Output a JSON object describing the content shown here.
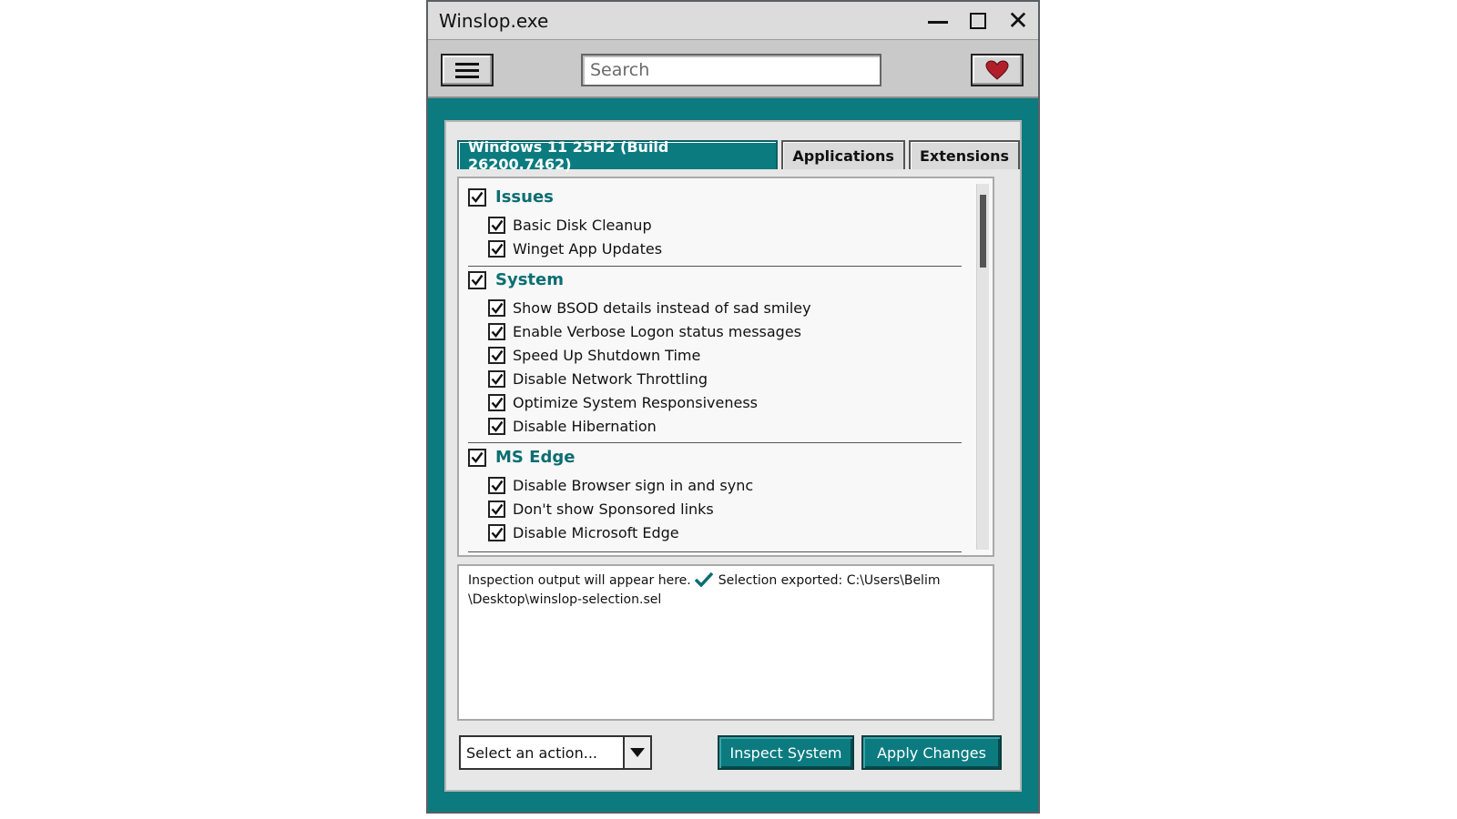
{
  "window": {
    "title": "Winslop.exe"
  },
  "toolbar": {
    "search_placeholder": "Search"
  },
  "tabs": [
    {
      "label": "Windows 11 25H2 (Build 26200.7462)",
      "active": true
    },
    {
      "label": "Applications",
      "active": false
    },
    {
      "label": "Extensions",
      "active": false
    }
  ],
  "groups": [
    {
      "title": "Issues",
      "checked": true,
      "items": [
        {
          "label": "Basic Disk Cleanup",
          "checked": true
        },
        {
          "label": "Winget App Updates",
          "checked": true
        }
      ]
    },
    {
      "title": "System",
      "checked": true,
      "items": [
        {
          "label": "Show BSOD details instead of sad smiley",
          "checked": true
        },
        {
          "label": "Enable Verbose Logon status messages",
          "checked": true
        },
        {
          "label": "Speed Up Shutdown Time",
          "checked": true
        },
        {
          "label": "Disable Network Throttling",
          "checked": true
        },
        {
          "label": "Optimize System Responsiveness",
          "checked": true
        },
        {
          "label": "Disable Hibernation",
          "checked": true
        }
      ]
    },
    {
      "title": "MS Edge",
      "checked": true,
      "items": [
        {
          "label": "Disable Browser sign in and sync",
          "checked": true
        },
        {
          "label": "Don't show Sponsored links",
          "checked": true
        },
        {
          "label": "Disable Microsoft Edge",
          "checked": true
        }
      ]
    }
  ],
  "output": {
    "placeholder_text": "Inspection output will appear here.",
    "export_text": "Selection exported: C:\\Users\\Belim",
    "export_path_cont": "\\Desktop\\winslop-selection.sel"
  },
  "actions": {
    "select_value": "Select an action...",
    "inspect_label": "Inspect System",
    "apply_label": "Apply Changes"
  },
  "colors": {
    "accent": "#0b7b80",
    "heart": "#b0202a"
  },
  "icons": [
    "hamburger-menu-icon",
    "heart-icon",
    "minimize-icon",
    "maximize-icon",
    "close-icon",
    "checkmark-icon",
    "dropdown-arrow-icon"
  ]
}
